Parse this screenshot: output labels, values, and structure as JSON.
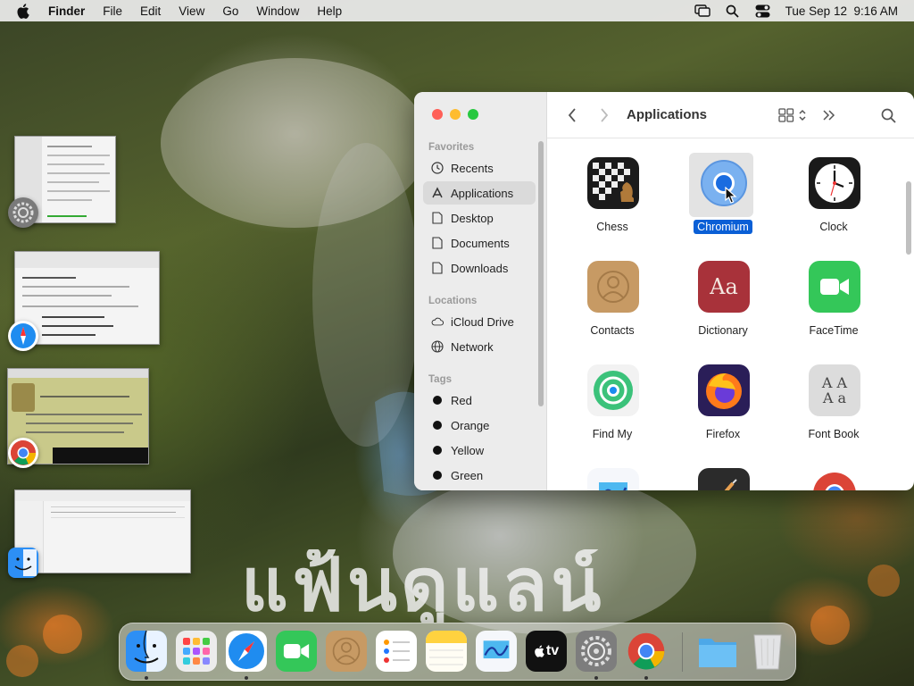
{
  "menubar": {
    "apple_icon": "apple-logo-icon",
    "app_name": "Finder",
    "menus": [
      "File",
      "Edit",
      "View",
      "Go",
      "Window",
      "Help"
    ],
    "status_icons": [
      "screen-mirroring-icon",
      "spotlight-search-icon",
      "control-center-icon"
    ],
    "datetime": "Tue Sep 12  9:16 AM"
  },
  "wallpaper": {
    "overlay_text": "แฟ้นดูแลน์"
  },
  "stage_manager": {
    "thumbnails": [
      {
        "app": "System Settings",
        "icon": "settings-gear-icon"
      },
      {
        "app": "Safari",
        "icon": "safari-compass-icon"
      },
      {
        "app": "Chrome",
        "icon": "chrome-icon"
      },
      {
        "app": "Finder",
        "icon": "finder-face-icon"
      }
    ]
  },
  "finder": {
    "title": "Applications",
    "sidebar": {
      "favorites_label": "Favorites",
      "favorites": [
        {
          "label": "Recents",
          "icon": "clock-icon"
        },
        {
          "label": "Applications",
          "icon": "applications-icon",
          "selected": true
        },
        {
          "label": "Desktop",
          "icon": "document-icon"
        },
        {
          "label": "Documents",
          "icon": "document-icon"
        },
        {
          "label": "Downloads",
          "icon": "document-icon"
        }
      ],
      "locations_label": "Locations",
      "locations": [
        {
          "label": "iCloud Drive",
          "icon": "cloud-icon"
        },
        {
          "label": "Network",
          "icon": "globe-icon"
        }
      ],
      "tags_label": "Tags",
      "tags": [
        {
          "label": "Red",
          "color": "#111111"
        },
        {
          "label": "Orange",
          "color": "#111111"
        },
        {
          "label": "Yellow",
          "color": "#111111"
        },
        {
          "label": "Green",
          "color": "#111111"
        }
      ]
    },
    "apps": [
      {
        "label": "Chess",
        "icon": "chess-icon"
      },
      {
        "label": "Chromium",
        "icon": "chromium-icon",
        "selected": true
      },
      {
        "label": "Clock",
        "icon": "clock-app-icon"
      },
      {
        "label": "Contacts",
        "icon": "contacts-icon"
      },
      {
        "label": "Dictionary",
        "icon": "dictionary-icon"
      },
      {
        "label": "FaceTime",
        "icon": "facetime-icon"
      },
      {
        "label": "Find My",
        "icon": "find-my-icon"
      },
      {
        "label": "Firefox",
        "icon": "firefox-icon"
      },
      {
        "label": "Font Book",
        "icon": "font-book-icon"
      },
      {
        "label": "",
        "icon": "freeform-icon"
      },
      {
        "label": "",
        "icon": "garageband-icon"
      },
      {
        "label": "",
        "icon": "google-chrome-icon"
      }
    ],
    "dictionary_glyph": "Aa",
    "fontbook_glyph": "A A\nA a"
  },
  "dock": {
    "items": [
      {
        "app": "Finder",
        "icon": "finder-icon",
        "running": true
      },
      {
        "app": "Launchpad",
        "icon": "launchpad-icon",
        "running": false
      },
      {
        "app": "Safari",
        "icon": "safari-icon",
        "running": true
      },
      {
        "app": "FaceTime",
        "icon": "facetime-icon",
        "running": false
      },
      {
        "app": "Contacts",
        "icon": "contacts-icon",
        "running": false
      },
      {
        "app": "Reminders",
        "icon": "reminders-icon",
        "running": false
      },
      {
        "app": "Notes",
        "icon": "notes-icon",
        "running": false
      },
      {
        "app": "Freeform",
        "icon": "freeform-icon",
        "running": false
      },
      {
        "app": "TV",
        "icon": "apple-tv-icon",
        "running": false
      },
      {
        "app": "System Settings",
        "icon": "settings-icon",
        "running": true
      },
      {
        "app": "Chrome",
        "icon": "chrome-icon",
        "running": true
      },
      {
        "app": "Downloads",
        "icon": "folder-icon",
        "running": false
      },
      {
        "app": "Trash",
        "icon": "trash-icon",
        "running": false
      }
    ],
    "tv_label": "tv"
  },
  "colors": {
    "selection_blue": "#0a5fd6",
    "traffic_close": "#ff5f57",
    "traffic_min": "#febc2e",
    "traffic_max": "#28c840"
  }
}
